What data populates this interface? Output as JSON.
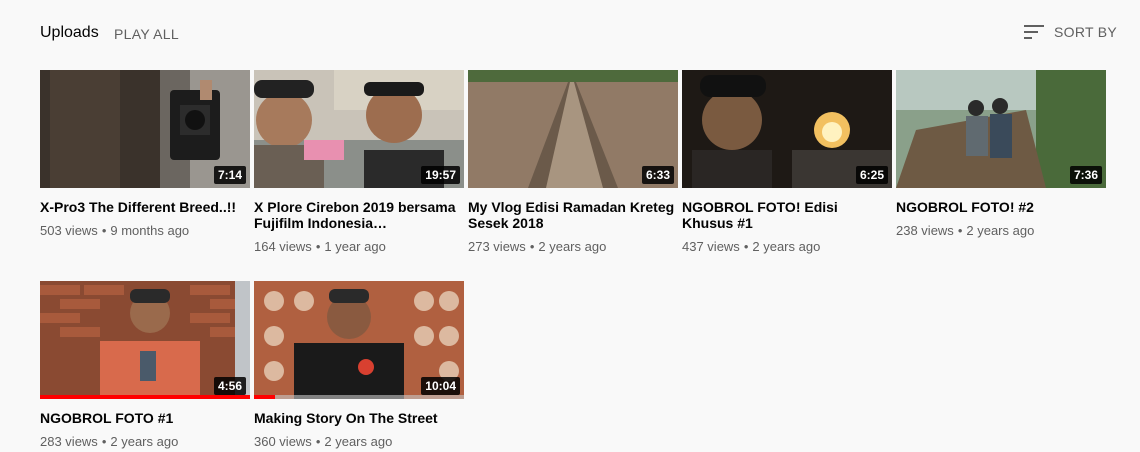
{
  "header": {
    "section_title": "Uploads",
    "play_all_label": "PLAY ALL",
    "sort_label": "SORT BY"
  },
  "videos": [
    {
      "title": "X-Pro3 The Different Breed..!!",
      "duration": "7:14",
      "views": "503 views",
      "age": "9 months ago"
    },
    {
      "title": "X Plore Cirebon 2019 bersama Fujifilm Indonesia…",
      "duration": "19:57",
      "views": "164 views",
      "age": "1 year ago"
    },
    {
      "title": "My Vlog Edisi Ramadan Kreteg Sesek 2018",
      "duration": "6:33",
      "views": "273 views",
      "age": "2 years ago"
    },
    {
      "title": "NGOBROL FOTO! Edisi Khusus #1",
      "duration": "6:25",
      "views": "437 views",
      "age": "2 years ago"
    },
    {
      "title": "NGOBROL FOTO! #2",
      "duration": "7:36",
      "views": "238 views",
      "age": "2 years ago"
    },
    {
      "title": "NGOBROL FOTO #1",
      "duration": "4:56",
      "views": "283 views",
      "age": "2 years ago",
      "watched_fraction": 1.0
    },
    {
      "title": "Making Story On The Street",
      "duration": "10:04",
      "views": "360 views",
      "age": "2 years ago",
      "watched_fraction": 0.1
    }
  ],
  "colors": {
    "progress": "#ff0000",
    "meta_text": "#606060"
  }
}
